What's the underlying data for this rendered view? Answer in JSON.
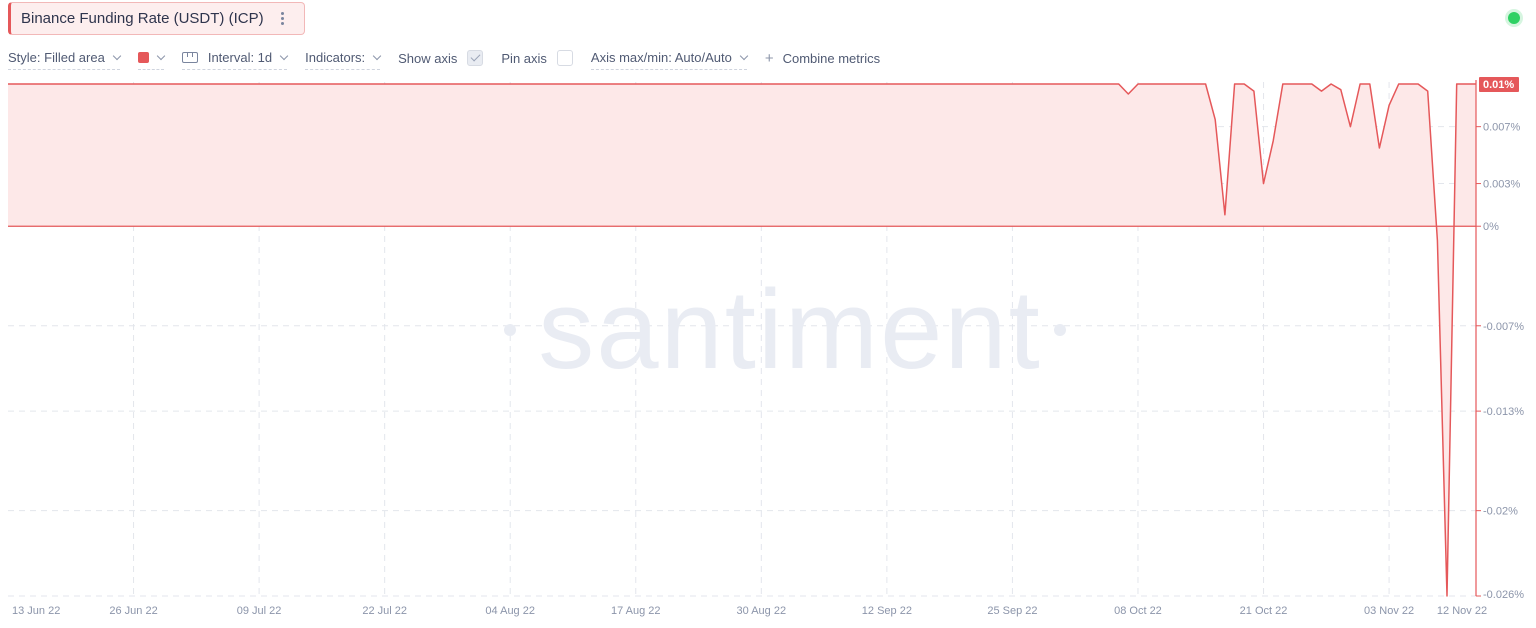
{
  "metric": {
    "title": "Binance Funding Rate (USDT) (ICP)"
  },
  "toolbar": {
    "style_label": "Style: Filled area",
    "interval_label": "Interval: 1d",
    "indicators_label": "Indicators:",
    "show_axis_label": "Show axis",
    "show_axis_checked": true,
    "pin_axis_label": "Pin axis",
    "pin_axis_checked": false,
    "axis_maxmin_label": "Axis max/min: Auto/Auto",
    "combine_label": "Combine metrics"
  },
  "colors": {
    "series": "#e5585a",
    "fill": "#fde8e8",
    "live": "#2fd164"
  },
  "watermark": "santiment",
  "chart_data": {
    "type": "area",
    "title": "Binance Funding Rate (USDT) (ICP)",
    "y_unit": "%",
    "x_range": [
      "2022-06-13",
      "2022-11-12"
    ],
    "ylim": [
      -0.026,
      0.01
    ],
    "x_tick_labels": [
      "13 Jun 22",
      "26 Jun 22",
      "09 Jul 22",
      "22 Jul 22",
      "04 Aug 22",
      "17 Aug 22",
      "30 Aug 22",
      "12 Sep 22",
      "25 Sep 22",
      "08 Oct 22",
      "21 Oct 22",
      "03 Nov 22",
      "12 Nov 22"
    ],
    "y_ticks": [
      {
        "value": 0.007,
        "label": "0.007%"
      },
      {
        "value": 0.003,
        "label": "0.003%"
      },
      {
        "value": 0,
        "label": "0%"
      },
      {
        "value": -0.007,
        "label": "-0.007%"
      },
      {
        "value": -0.013,
        "label": "-0.013%"
      },
      {
        "value": -0.02,
        "label": "-0.02%"
      },
      {
        "value": -0.026,
        "label": "-0.026%"
      }
    ],
    "last_value_label": "0.01%",
    "grid": true,
    "series": [
      {
        "x": [
          "2022-06-13",
          "2022-10-06",
          "2022-10-07",
          "2022-10-08",
          "2022-10-15",
          "2022-10-16",
          "2022-10-17",
          "2022-10-18",
          "2022-10-19",
          "2022-10-20",
          "2022-10-21",
          "2022-10-22",
          "2022-10-23",
          "2022-10-24",
          "2022-10-25",
          "2022-10-26",
          "2022-10-27",
          "2022-10-28",
          "2022-10-29",
          "2022-10-30",
          "2022-10-31",
          "2022-11-01",
          "2022-11-02",
          "2022-11-03",
          "2022-11-04",
          "2022-11-05",
          "2022-11-06",
          "2022-11-07",
          "2022-11-08",
          "2022-11-09",
          "2022-11-10",
          "2022-11-11",
          "2022-11-12"
        ],
        "y": [
          0.01,
          0.01,
          0.0093,
          0.01,
          0.01,
          0.0075,
          0.0008,
          0.01,
          0.01,
          0.0095,
          0.003,
          0.006,
          0.01,
          0.01,
          0.01,
          0.01,
          0.0095,
          0.01,
          0.0096,
          0.007,
          0.01,
          0.01,
          0.0055,
          0.0085,
          0.01,
          0.01,
          0.01,
          0.0095,
          -0.001,
          -0.026,
          0.01,
          0.01,
          0.01
        ]
      }
    ]
  }
}
